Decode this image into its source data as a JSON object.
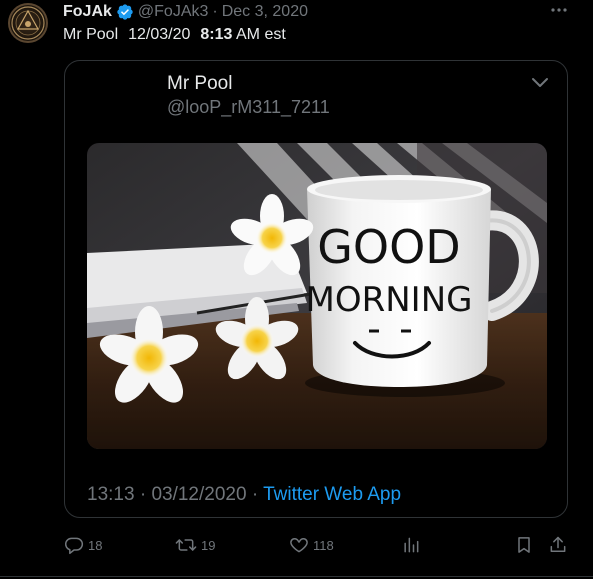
{
  "tweet": {
    "display_name": "FoJAk",
    "handle": "@FoJAk3",
    "separator": "·",
    "date": "Dec 3, 2020",
    "text_parts": {
      "name": "Mr Pool",
      "date": "12/03/20",
      "time": "8:13",
      "suffix": "AM est"
    }
  },
  "quote": {
    "display_name": "Mr Pool",
    "handle": "@looP_rM311_7211",
    "image": {
      "mug_text_line1": "GOOD",
      "mug_text_line2": "MORNING",
      "mug_face": "- -"
    },
    "time": "13:13",
    "separator": "·",
    "date": "03/12/2020",
    "source": "Twitter Web App"
  },
  "actions": {
    "replies": "18",
    "retweets": "19",
    "likes": "118"
  },
  "colors": {
    "background": "#000000",
    "text_primary": "#e7e9ea",
    "text_secondary": "#71767b",
    "accent_blue": "#1d9bf0",
    "border": "#2f3336"
  },
  "icons": [
    "avatar-emblem",
    "verified-badge-icon",
    "more-icon",
    "chevron-down-icon",
    "reply-icon",
    "retweet-icon",
    "like-icon",
    "views-icon",
    "bookmark-icon",
    "share-icon"
  ]
}
